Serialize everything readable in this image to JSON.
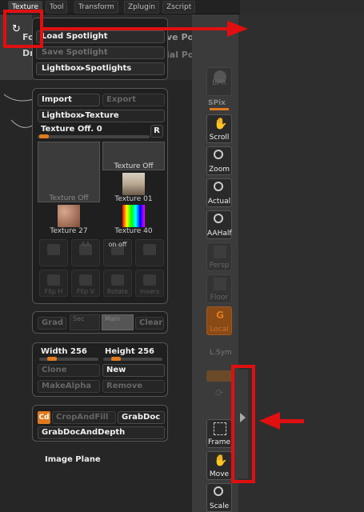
{
  "menu": {
    "tabs": [
      "Texture",
      "Tool",
      "Transform",
      "Zplugin",
      "Zscript"
    ],
    "active": "Texture"
  },
  "background": {
    "under_text_1": "Fo",
    "under_text_2": "Dr",
    "under_right_1": "ve Po",
    "under_right_2": "ial Poir"
  },
  "popup": {
    "items": [
      "Load Spotlight",
      "Save Spotlight",
      "Lightbox▸Spotlights"
    ]
  },
  "texture_panel": {
    "import_label": "Import",
    "export_label": "Export",
    "lightbox_label": "Lightbox▸Texture",
    "offset_label": "Texture Off. 0",
    "r_label": "R",
    "textures": [
      "Texture Off",
      "Texture Off",
      "Texture 01",
      "Texture 27",
      "Texture 40"
    ],
    "tools_row1": [
      "",
      "AA",
      "on  off",
      ""
    ],
    "tools_row2": [
      "Flip H",
      "Flip V",
      "Rotate",
      "Invers"
    ]
  },
  "grad_panel": {
    "grad_label": "Grad",
    "sec_label": "Sec",
    "main_label": "Main",
    "clear_label": "Clear"
  },
  "size_panel": {
    "width_label": "Width 256",
    "height_label": "Height 256",
    "clone_label": "Clone",
    "new_label": "New",
    "makealpha_label": "MakeAlpha",
    "remove_label": "Remove"
  },
  "grab_panel": {
    "cd_label": "Cd",
    "cropandfill_label": "CropAndFill",
    "grabdoc_label": "GrabDoc",
    "grabdocdepth_label": "GrabDocAndDepth"
  },
  "image_plane_label": "Image Plane",
  "shelf": {
    "bpr": "BPR",
    "spix": "SPix",
    "scroll": "Scroll",
    "zoom": "Zoom",
    "actual": "Actual",
    "aahalf": "AAHalf",
    "persp": "Persp",
    "floor": "Floor",
    "local": "Local",
    "lsym": "L.Sym",
    "frame": "Frame",
    "move": "Move",
    "scale": "Scale"
  },
  "colors": {
    "accent": "#e07a1f",
    "annotation": "#e01010"
  }
}
